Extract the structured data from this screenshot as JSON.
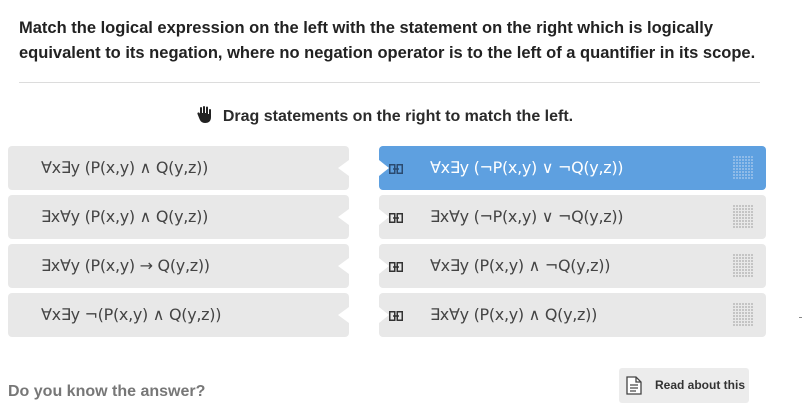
{
  "question": "Match the logical expression on the left with the statement on the right which is logically equivalent to its negation, where no negation operator is to the left of a quantifier in its scope.",
  "instruction": "Drag statements on the right to match the left.",
  "left_items": [
    {
      "expr": "∀x∃y (P(x,y) ∧ Q(y,z))"
    },
    {
      "expr": "∃x∀y (P(x,y) ∧ Q(y,z))"
    },
    {
      "expr": "∃x∀y (P(x,y) → Q(y,z))"
    },
    {
      "expr": "∀x∃y ¬(P(x,y) ∧ Q(y,z))"
    }
  ],
  "right_items": [
    {
      "expr": "∀x∃y (¬P(x,y) ∨ ¬Q(y,z))",
      "selected": true
    },
    {
      "expr": "∃x∀y (¬P(x,y) ∨ ¬Q(y,z))",
      "selected": false
    },
    {
      "expr": "∀x∃y (P(x,y) ∧ ¬Q(y,z))",
      "selected": false
    },
    {
      "expr": "∃x∀y (P(x,y) ∧ Q(y,z))",
      "selected": false
    }
  ],
  "footer": {
    "prompt": "Do you know the answer?",
    "read_button": "Read about this"
  },
  "colors": {
    "selected": "#5ea0e0",
    "item_bg": "#e8e8e8"
  },
  "icons": {
    "instruction": "hand-icon",
    "link": "link-icon",
    "grip": "drag-grip-icon",
    "document": "document-icon"
  }
}
